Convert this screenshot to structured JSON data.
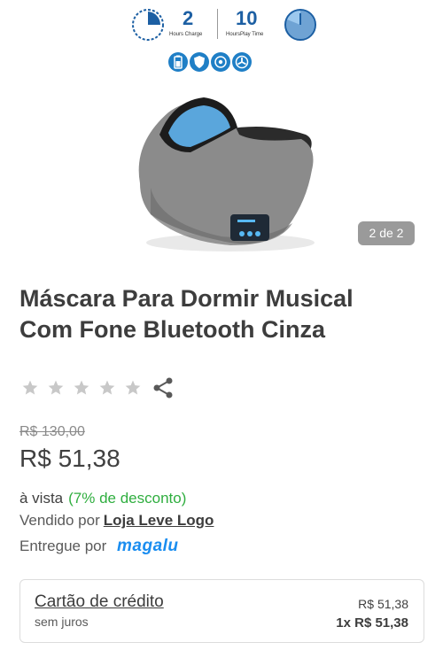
{
  "product_image": {
    "promo": {
      "hours_charge_value": "2",
      "hours_charge_caption": "Hours Charge",
      "hours_play_value": "10",
      "hours_play_caption": "HoursPlay Time"
    },
    "feature_icons": [
      "battery-icon",
      "shield-icon",
      "speaker-icon",
      "fan-icon"
    ],
    "counter": "2 de 2"
  },
  "product": {
    "title_line1": "Máscara Para Dormir Musical",
    "title_line2": "Com Fone Bluetooth Cinza",
    "rating": 0,
    "rating_max": 5
  },
  "pricing": {
    "old_price": "R$ 130,00",
    "price": "R$ 51,38",
    "cash_label": "à vista",
    "discount": "(7% de desconto)",
    "sold_by_label": "Vendido por",
    "seller": "Loja Leve Logo",
    "delivered_by_label": "Entregue por",
    "delivered_by_logo": "magalu"
  },
  "payment": {
    "title": "Cartão de crédito",
    "subtitle": "sem juros",
    "total": "R$ 51,38",
    "installment": "1x R$ 51,38"
  },
  "colors": {
    "discount_green": "#2fae3f",
    "magalu_blue": "#1a8df0",
    "mask_lining_blue": "#5aa6dc"
  }
}
